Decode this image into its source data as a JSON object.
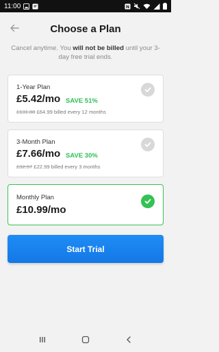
{
  "status_bar": {
    "time": "11:00",
    "icons": [
      "photo-icon",
      "message-icon",
      "nfc-icon",
      "mute-icon",
      "wifi-icon",
      "signal-icon",
      "battery-icon"
    ]
  },
  "header": {
    "title": "Choose a Plan",
    "back_icon": "back-arrow-icon"
  },
  "subtitle": {
    "part1": "Cancel anytime. You ",
    "bold": "will not be billed",
    "part2": " until your 3-day free trial ends."
  },
  "plans": [
    {
      "name": "1-Year Plan",
      "price": "£5.42/mo",
      "save": "SAVE 51%",
      "old_price": "£131.88",
      "billed": " £64.99 billed every 12 months",
      "selected": false
    },
    {
      "name": "3-Month Plan",
      "price": "£7.66/mo",
      "save": "SAVE 30%",
      "old_price": "£32.97",
      "billed": " £22.99 billed every 3 months",
      "selected": false
    },
    {
      "name": "Monthly Plan",
      "price": "£10.99/mo",
      "selected": true
    }
  ],
  "cta": {
    "label": "Start Trial"
  },
  "colors": {
    "accent_green": "#34c253",
    "cta_blue": "#1a84ee",
    "background": "#f2f2f2"
  },
  "nav_bar": {
    "icons": [
      "recent-apps-icon",
      "home-icon",
      "back-icon"
    ]
  }
}
